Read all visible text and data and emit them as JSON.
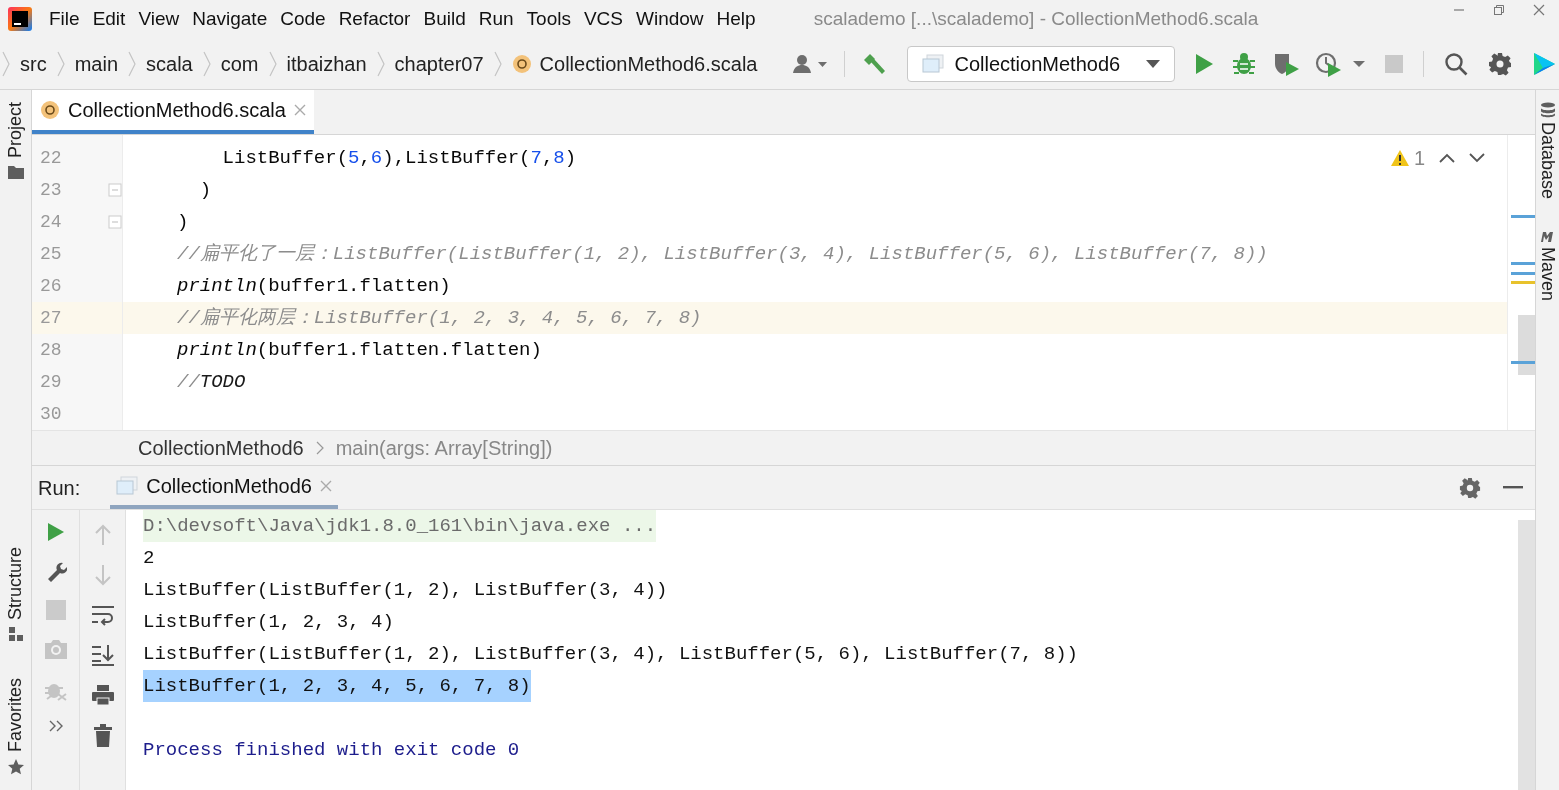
{
  "window": {
    "title": "scalademo [...\\scalademo] - CollectionMethod6.scala"
  },
  "menu": [
    {
      "label": "File"
    },
    {
      "label": "Edit"
    },
    {
      "label": "View"
    },
    {
      "label": "Navigate"
    },
    {
      "label": "Code"
    },
    {
      "label": "Refactor"
    },
    {
      "label": "Build"
    },
    {
      "label": "Run"
    },
    {
      "label": "Tools"
    },
    {
      "label": "VCS"
    },
    {
      "label": "Window"
    },
    {
      "label": "Help"
    }
  ],
  "breadcrumbs": [
    {
      "label": "src",
      "kind": "folder"
    },
    {
      "label": "main",
      "kind": "folder"
    },
    {
      "label": "scala",
      "kind": "folder"
    },
    {
      "label": "com",
      "kind": "folder"
    },
    {
      "label": "itbaizhan",
      "kind": "folder"
    },
    {
      "label": "chapter07",
      "kind": "folder"
    },
    {
      "label": "CollectionMethod6.scala",
      "kind": "file"
    }
  ],
  "run_configuration": "CollectionMethod6",
  "tool_windows": {
    "left_top": [
      "Project"
    ],
    "left_bottom": [
      "Structure",
      "Favorites"
    ],
    "right": [
      "Database",
      "Maven"
    ]
  },
  "editor": {
    "tabs": [
      {
        "label": "CollectionMethod6.scala",
        "selected": true
      }
    ],
    "warning_count": "1",
    "lines": [
      {
        "number": "22",
        "current": false,
        "fold": false,
        "segments": [
          {
            "text": "    ListBuffer(",
            "kind": "plain"
          },
          {
            "text": "5",
            "kind": "number"
          },
          {
            "text": ",",
            "kind": "plain"
          },
          {
            "text": "6",
            "kind": "number"
          },
          {
            "text": "),ListBuffer(",
            "kind": "plain"
          },
          {
            "text": "7",
            "kind": "number"
          },
          {
            "text": ",",
            "kind": "plain"
          },
          {
            "text": "8",
            "kind": "number"
          },
          {
            "text": ")",
            "kind": "plain"
          }
        ]
      },
      {
        "number": "23",
        "current": false,
        "fold": true,
        "segments": [
          {
            "text": "  )",
            "kind": "plain"
          }
        ]
      },
      {
        "number": "24",
        "current": false,
        "fold": true,
        "segments": [
          {
            "text": ")",
            "kind": "plain"
          }
        ]
      },
      {
        "number": "25",
        "current": false,
        "fold": false,
        "segments": [
          {
            "text": "//扁平化了一层：ListBuffer(ListBuffer(1, 2), ListBuffer(3, 4), ListBuffer(5, 6), ListBuffer(7, 8))",
            "kind": "comment"
          }
        ]
      },
      {
        "number": "26",
        "current": false,
        "fold": false,
        "segments": [
          {
            "text": "println",
            "kind": "method"
          },
          {
            "text": "(buffer1.flatten)",
            "kind": "plain"
          }
        ]
      },
      {
        "number": "27",
        "current": true,
        "fold": false,
        "segments": [
          {
            "text": "//扁平化两层：ListBuffer(1, 2, 3, 4, 5, 6, 7, 8)",
            "kind": "comment"
          }
        ]
      },
      {
        "number": "28",
        "current": false,
        "fold": false,
        "segments": [
          {
            "text": "println",
            "kind": "method"
          },
          {
            "text": "(buffer1.flatten.flatten)",
            "kind": "plain"
          }
        ]
      },
      {
        "number": "29",
        "current": false,
        "fold": false,
        "segments": [
          {
            "text": "//",
            "kind": "comment"
          },
          {
            "text": "TODO",
            "kind": "todo"
          }
        ]
      },
      {
        "number": "30",
        "current": false,
        "fold": false
      }
    ],
    "breadcrumb": [
      "CollectionMethod6",
      "main(args: Array[String])"
    ]
  },
  "run_panel": {
    "label": "Run:",
    "tabs": [
      {
        "label": "CollectionMethod6",
        "selected": true
      }
    ],
    "output": [
      {
        "text": "D:\\devsoft\\Java\\jdk1.8.0_161\\bin\\java.exe ...",
        "kind": "command"
      },
      {
        "text": "2",
        "kind": "plain"
      },
      {
        "text": "ListBuffer(ListBuffer(1, 2), ListBuffer(3, 4))",
        "kind": "plain"
      },
      {
        "text": "ListBuffer(1, 2, 3, 4)",
        "kind": "plain"
      },
      {
        "text": "ListBuffer(ListBuffer(1, 2), ListBuffer(3, 4), ListBuffer(5, 6), ListBuffer(7, 8))",
        "kind": "plain"
      },
      {
        "text": "ListBuffer(1, 2, 3, 4, 5, 6, 7, 8)",
        "kind": "selected"
      },
      {
        "text": "Process finished with exit code 0",
        "kind": "process"
      }
    ]
  }
}
